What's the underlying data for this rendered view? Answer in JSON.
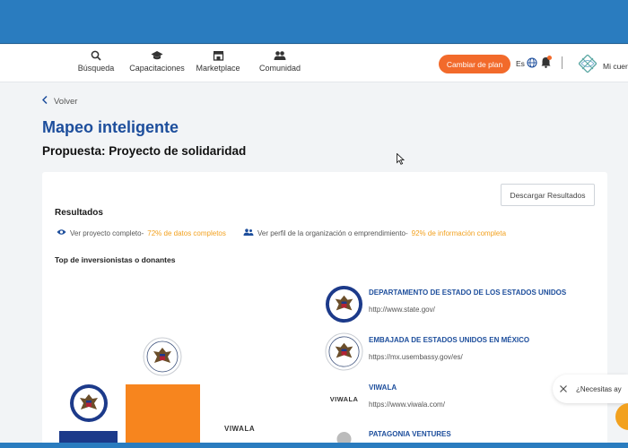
{
  "nav": {
    "items": [
      {
        "label": "Búsqueda",
        "icon": "search-icon"
      },
      {
        "label": "Capacitaciones",
        "icon": "graduation-cap-icon"
      },
      {
        "label": "Marketplace",
        "icon": "store-icon"
      },
      {
        "label": "Comunidad",
        "icon": "community-icon"
      }
    ],
    "plan_button": "Cambiar de plan",
    "language": "Es",
    "account_label": "Mi cuer"
  },
  "page": {
    "back_label": "Volver",
    "title": "Mapeo inteligente",
    "subtitle": "Propuesta: Proyecto de solidaridad"
  },
  "results": {
    "download_button": "Descargar Resultados",
    "title": "Resultados",
    "project_link": {
      "text": "Ver proyecto completo-",
      "highlight": "72% de datos completos"
    },
    "profile_link": {
      "text": "Ver perfil de la organización o emprendimiento-",
      "highlight": "92% de información completa"
    },
    "top_title": "Top de inversionistas o donantes",
    "chart_logo_text": "VIWALA",
    "organizations": [
      {
        "name": "DEPARTAMENTO DE ESTADO DE LOS ESTADOS UNIDOS",
        "url": "http://www.state.gov/",
        "logo": "us-state-seal-icon"
      },
      {
        "name": "EMBAJADA DE ESTADOS UNIDOS EN MÉXICO",
        "url": "https://mx.usembassy.gov/es/",
        "logo": "us-embassy-seal-icon"
      },
      {
        "name": "VIWALA",
        "url": "https://www.viwala.com/",
        "logo_text": "VIWALA"
      },
      {
        "name": "PATAGONIA VENTURES",
        "url": "",
        "logo": "patagonia-logo-icon"
      }
    ]
  },
  "chat": {
    "prompt": "¿Necesitas ay"
  },
  "colors": {
    "brand_blue": "#2a7cbf",
    "title_blue": "#1d4e9c",
    "accent_orange": "#f26a2b",
    "highlight_yellow": "#f2a11f"
  }
}
